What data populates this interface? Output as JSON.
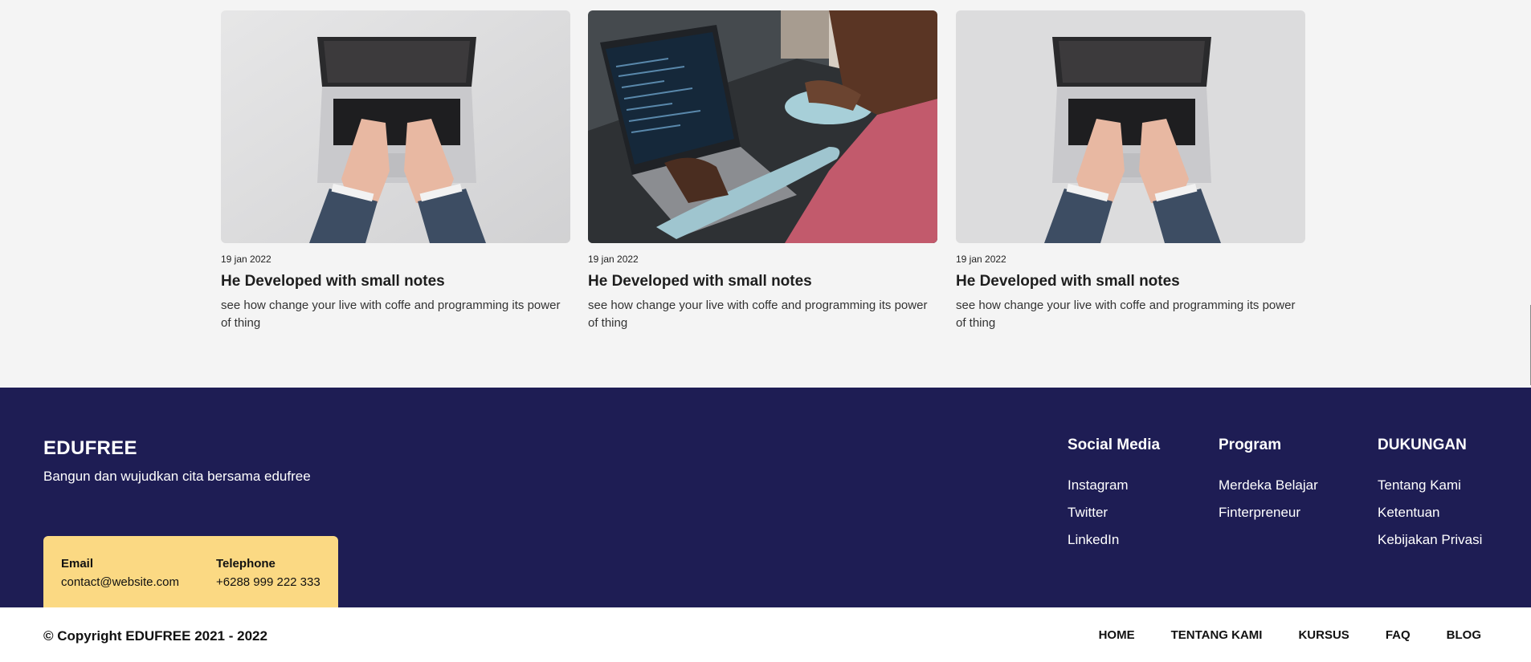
{
  "blog": {
    "cards": [
      {
        "image": "laptop-typing-photo",
        "date": "19 jan 2022",
        "title": "He Developed with small notes",
        "description": "see how change your live with coffe and programming its power of thing"
      },
      {
        "image": "developer-coding-photo",
        "date": "19 jan 2022",
        "title": "He Developed with small notes",
        "description": "see how change your live with coffe and programming its power of thing"
      },
      {
        "image": "laptop-typing-photo",
        "date": "19 jan 2022",
        "title": "He Developed with small notes",
        "description": "see how change your live with coffe and programming its power of thing"
      }
    ]
  },
  "footer": {
    "brand": "EDUFREE",
    "tagline": "Bangun dan wujudkan cita bersama edufree",
    "contact": {
      "email_label": "Email",
      "email_value": "contact@website.com",
      "phone_label": "Telephone",
      "phone_value": "+6288 999 222 333"
    },
    "columns": [
      {
        "title": "Social Media",
        "links": [
          "Instagram",
          "Twitter",
          "LinkedIn"
        ]
      },
      {
        "title": "Program",
        "links": [
          "Merdeka Belajar",
          "Finterpreneur"
        ]
      },
      {
        "title": "DUKUNGAN",
        "links": [
          "Tentang Kami",
          "Ketentuan",
          "Kebijakan Privasi"
        ]
      }
    ]
  },
  "bottom": {
    "copyright": "© Copyright EDUFREE 2021 - 2022",
    "nav": [
      "HOME",
      "TENTANG KAMI",
      "KURSUS",
      "FAQ",
      "BLOG"
    ]
  },
  "colors": {
    "footer_bg": "#1e1d54",
    "contact_bg": "#fbd983",
    "page_bg": "#f4f4f4"
  }
}
